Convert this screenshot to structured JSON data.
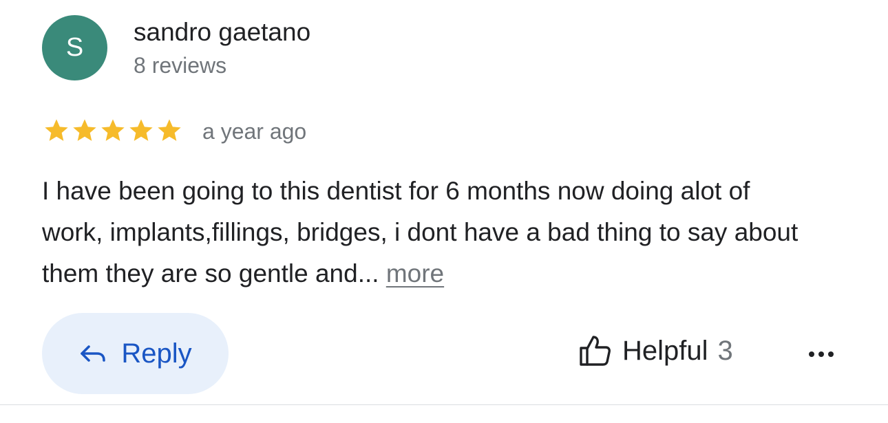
{
  "reviewer": {
    "initial": "S",
    "name": "sandro gaetano",
    "meta": "8 reviews",
    "avatar_color": "#3a8a7a"
  },
  "review": {
    "rating": 5,
    "max_rating": 5,
    "star_color": "#f6bb2b",
    "date": "a year ago",
    "text": "I have been going to this dentist for 6 months now doing alot of work, implants,fillings, bridges, i dont have a bad thing to say about them they are so gentle and... ",
    "more_label": "more"
  },
  "actions": {
    "reply_label": "Reply",
    "reply_icon": "reply-arrow-icon",
    "helpful_label": "Helpful",
    "helpful_count": "3",
    "helpful_icon": "thumbs-up-icon",
    "overflow_icon": "more-horizontal-icon"
  },
  "colors": {
    "accent_blue": "#1a56c4",
    "reply_bg": "#e8f0fb",
    "secondary_text": "#70757a"
  }
}
